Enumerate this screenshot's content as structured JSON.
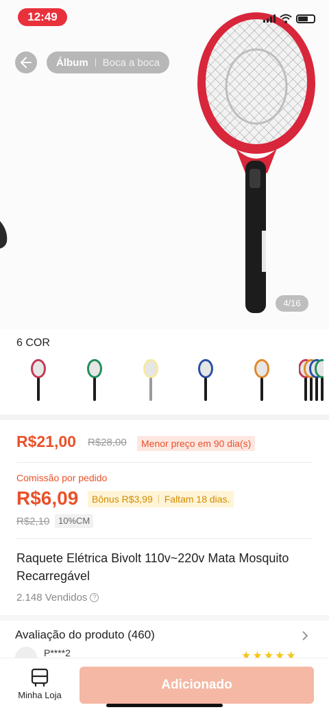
{
  "status_bar": {
    "time": "12:49"
  },
  "gallery": {
    "tabs": [
      {
        "label": "Álbum"
      },
      {
        "label": "Boca a boca"
      }
    ],
    "counter": "4/16"
  },
  "variants": {
    "label": "6 COR",
    "items": [
      {
        "color": "#c23a55"
      },
      {
        "color": "#1f8f5a"
      },
      {
        "color": "#f6e9a0"
      },
      {
        "color": "#2b4fa5"
      },
      {
        "color": "#e08a2a"
      },
      {
        "color": "mixed"
      }
    ]
  },
  "pricing": {
    "price": "R$21,00",
    "old_price": "R$28,00",
    "low_price_badge": "Menor preço em 90 dia(s)",
    "commission_label": "Comissão por pedido",
    "commission_value": "R$6,09",
    "bonus": "Bônus R$3,99",
    "bonus_time": "Faltam 18 dias.",
    "commission_old": "R$2,10",
    "commission_rate": "10%CM"
  },
  "product": {
    "title": "Raquete Elétrica Bivolt 110v~220v Mata Mosquito Recarregável",
    "sold": "2.148 Vendidos"
  },
  "reviews": {
    "title": "Avaliação do produto (460)",
    "first_reviewer": "P****2",
    "rating": 5
  },
  "bottom_bar": {
    "store_label": "Minha Loja",
    "add_label": "Adicionado"
  },
  "colors": {
    "accent": "#e9512a",
    "status_pill": "#e8313b",
    "add_button": "#f4b8a4"
  }
}
